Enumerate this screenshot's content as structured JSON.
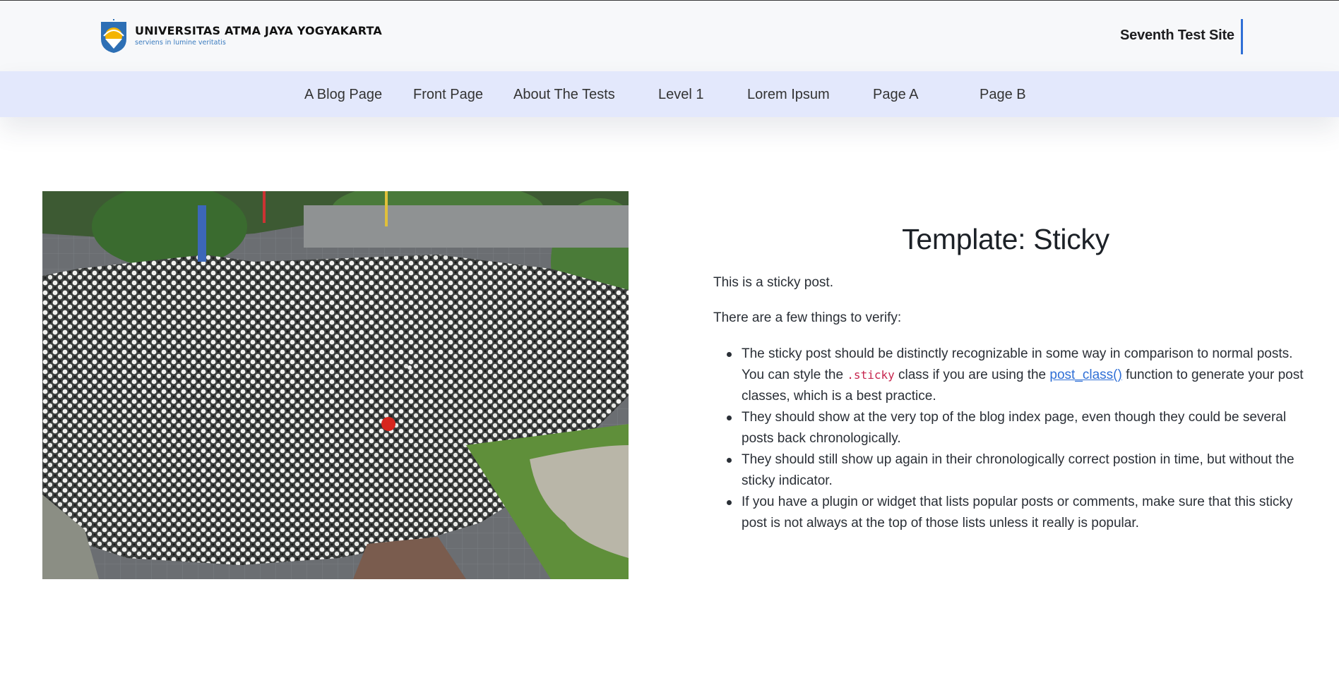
{
  "header": {
    "logo": {
      "title": "UNIVERSITAS ATMA JAYA YOGYAKARTA",
      "motto": "serviens in lumine veritatis"
    },
    "site_title": "Seventh Test Site",
    "accent_color": "#2f6fd6"
  },
  "nav": {
    "items": [
      {
        "label": "A Blog Page"
      },
      {
        "label": "Front Page"
      },
      {
        "label": "About The Tests"
      },
      {
        "label": "Level 1"
      },
      {
        "label": "Lorem Ipsum"
      },
      {
        "label": "Page A"
      },
      {
        "label": "Page B"
      }
    ],
    "background": "#e3e8fc"
  },
  "post": {
    "title": "Template: Sticky",
    "intro": "This is a sticky post.",
    "lead": "There are a few things to verify:",
    "bullet1": {
      "part1": "The sticky post should be distinctly recognizable in some way in comparison to normal posts. You can style the ",
      "code": ".sticky",
      "part2": " class if you are using the ",
      "link": "post_class()",
      "part3": " function to generate your post classes, which is a best practice."
    },
    "bullet2": "They should show at the very top of the blog index page, even though they could be several posts back chronologically.",
    "bullet3": "They should still show up again in their chronologically correct postion in time, but without the sticky indicator.",
    "bullet4": "If you have a plugin or widget that lists popular posts or comments, make sure that this sticky post is not always at the top of those lists unless it really is popular.",
    "code_color": "#c7254e",
    "link_color": "#2f6fd6"
  },
  "image": {
    "icon": "crowd-photo"
  }
}
